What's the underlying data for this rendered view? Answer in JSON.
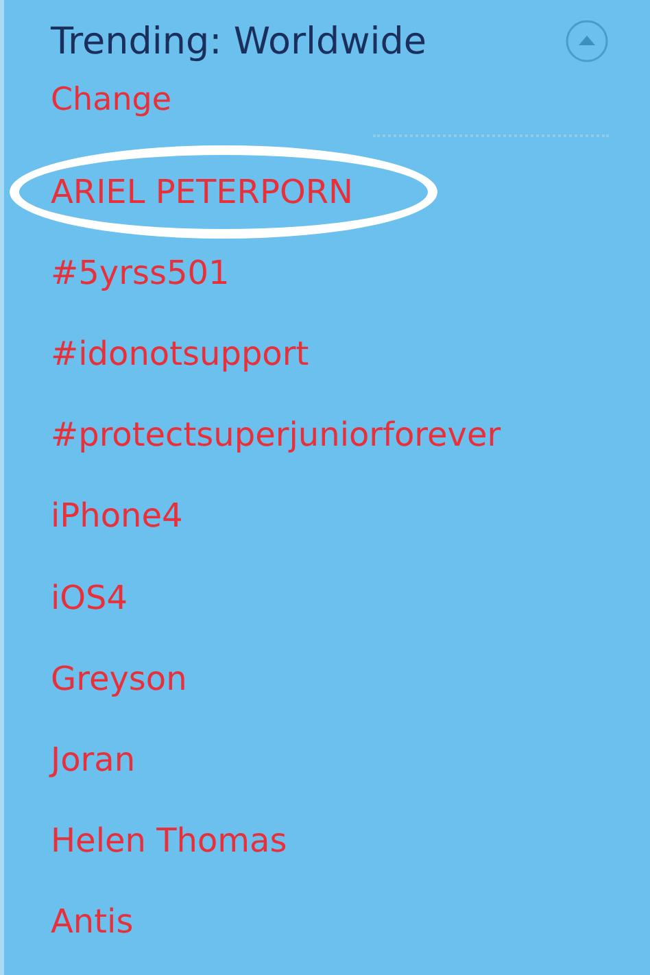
{
  "panel": {
    "title": "Trending: Worldwide",
    "change_link": "Change",
    "trends": [
      {
        "label": "ARIEL PETERPORN",
        "circled": true
      },
      {
        "label": "#5yrss501",
        "circled": false
      },
      {
        "label": "#idonotsupport",
        "circled": false
      },
      {
        "label": "#protectsuperjuniorforever",
        "circled": false
      },
      {
        "label": "iPhone4",
        "circled": false
      },
      {
        "label": "iOS4",
        "circled": false
      },
      {
        "label": "Greyson",
        "circled": false
      },
      {
        "label": "Joran",
        "circled": false
      },
      {
        "label": "Helen Thomas",
        "circled": false
      },
      {
        "label": "Antis",
        "circled": false
      }
    ]
  }
}
